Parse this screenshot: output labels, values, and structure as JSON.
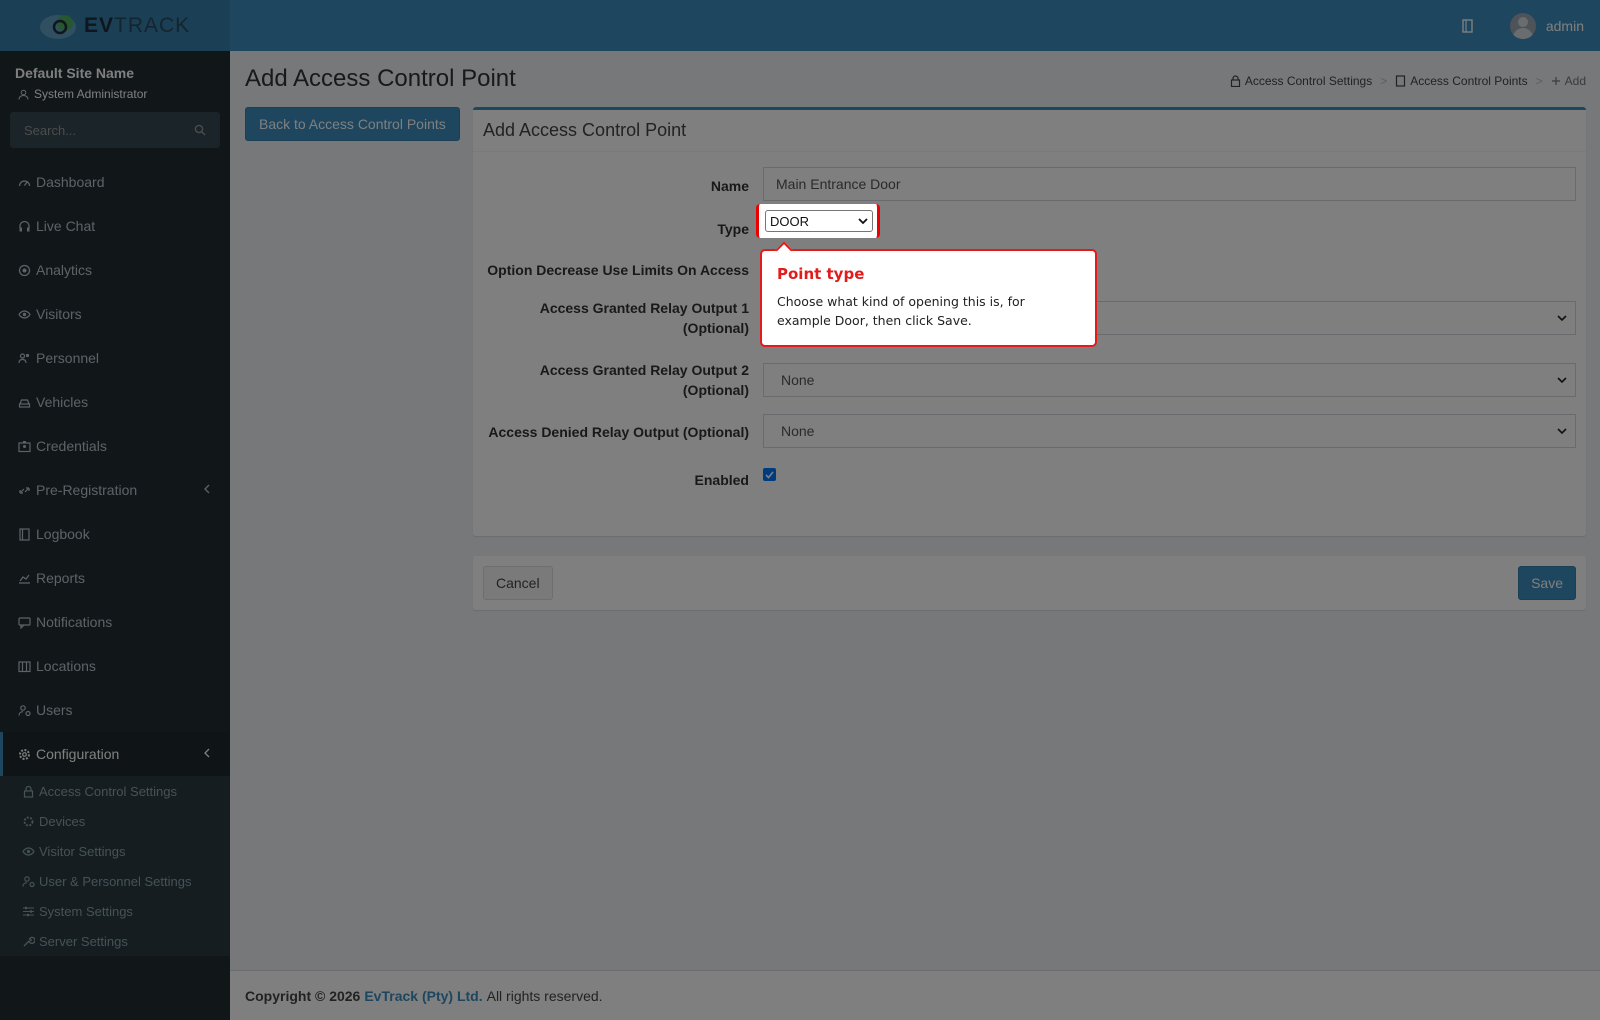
{
  "header": {
    "logo_text_bold": "EV",
    "logo_text_rest": "TRACK",
    "user_name": "admin",
    "icons": [
      "book-icon",
      "user-avatar"
    ]
  },
  "sidebar": {
    "site_name": "Default Site Name",
    "site_role": "System Administrator",
    "search_placeholder": "Search...",
    "items": [
      {
        "label": "Dashboard",
        "icon": "dashboard-icon"
      },
      {
        "label": "Live Chat",
        "icon": "headset-icon"
      },
      {
        "label": "Analytics",
        "icon": "target-icon"
      },
      {
        "label": "Visitors",
        "icon": "eye-icon"
      },
      {
        "label": "Personnel",
        "icon": "users-icon"
      },
      {
        "label": "Vehicles",
        "icon": "car-icon"
      },
      {
        "label": "Credentials",
        "icon": "id-card-icon"
      },
      {
        "label": "Pre-Registration",
        "icon": "arrows-icon"
      },
      {
        "label": "Logbook",
        "icon": "book-icon"
      },
      {
        "label": "Reports",
        "icon": "chart-icon"
      },
      {
        "label": "Notifications",
        "icon": "chat-icon"
      },
      {
        "label": "Locations",
        "icon": "map-icon"
      },
      {
        "label": "Users",
        "icon": "user-cog-icon"
      },
      {
        "label": "Configuration",
        "icon": "gear-icon"
      }
    ],
    "subitems": [
      {
        "label": "Access Control Settings",
        "icon": "lock-icon"
      },
      {
        "label": "Devices",
        "icon": "chip-icon"
      },
      {
        "label": "Visitor Settings",
        "icon": "eye-icon"
      },
      {
        "label": "User & Personnel Settings",
        "icon": "user-cog-icon"
      },
      {
        "label": "System Settings",
        "icon": "sliders-icon"
      },
      {
        "label": "Server Settings",
        "icon": "wrench-icon"
      }
    ]
  },
  "page": {
    "title": "Add Access Control Point",
    "breadcrumb": [
      "Access Control Settings",
      "Access Control Points",
      "Add"
    ],
    "back_button": "Back to Access Control Points"
  },
  "form": {
    "header": "Add Access Control Point",
    "name_label": "Name",
    "name_value": "Main Entrance Door",
    "type_label": "Type",
    "type_value": "DOOR",
    "option_label": "Option Decrease Use Limits On Access",
    "relay1_label_line1": "Access Granted Relay Output 1",
    "relay1_label_line2": "(Optional)",
    "relay2_label_line1": "Access Granted Relay Output 2",
    "relay2_label_line2": "(Optional)",
    "relay2_value": "None",
    "denied_label": "Access Denied Relay Output (Optional)",
    "denied_value": "None",
    "enabled_label": "Enabled",
    "enabled_checked": true
  },
  "actions": {
    "cancel": "Cancel",
    "save": "Save"
  },
  "footer": {
    "copyright": "Copyright © 2026",
    "company": "EvTrack (Pty) Ltd.",
    "rights": "All rights reserved."
  },
  "tooltip": {
    "title": "Point type",
    "body": "Choose what kind of opening this is, for example Door, then click Save."
  },
  "colors": {
    "primary": "#3c8dbc",
    "sidebar": "#222d32",
    "highlight": "#e21b1b"
  }
}
